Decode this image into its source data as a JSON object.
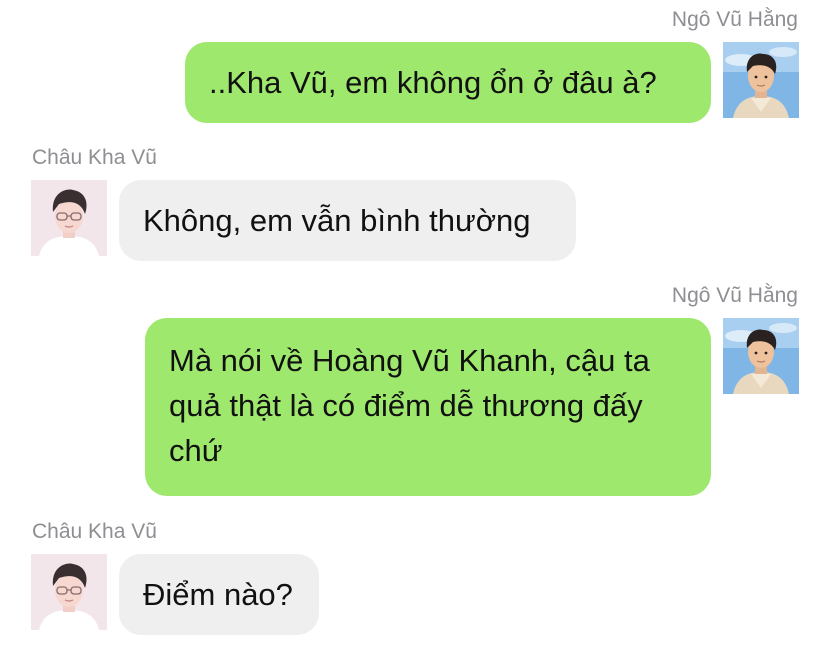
{
  "messages": [
    {
      "direction": "outgoing",
      "sender": "Ngô Vũ Hằng",
      "text": "..Kha Vũ, em không ổn ở đâu à?",
      "avatar_icon": "sky-boy-avatar"
    },
    {
      "direction": "incoming",
      "sender": "Châu Kha Vũ",
      "text": "Không, em vẫn bình thường",
      "avatar_icon": "glasses-boy-avatar"
    },
    {
      "direction": "outgoing",
      "sender": "Ngô Vũ Hằng",
      "text": "Mà nói về Hoàng Vũ Khanh, cậu ta quả thật là có điểm dễ thương đấy chứ",
      "avatar_icon": "sky-boy-avatar"
    },
    {
      "direction": "incoming",
      "sender": "Châu Kha Vũ",
      "text": "Điểm nào?",
      "avatar_icon": "glasses-boy-avatar"
    }
  ],
  "colors": {
    "outgoing_bubble": "#9ee86e",
    "incoming_bubble": "#efefef",
    "sender_name": "#8e8e93",
    "text": "#111111"
  }
}
